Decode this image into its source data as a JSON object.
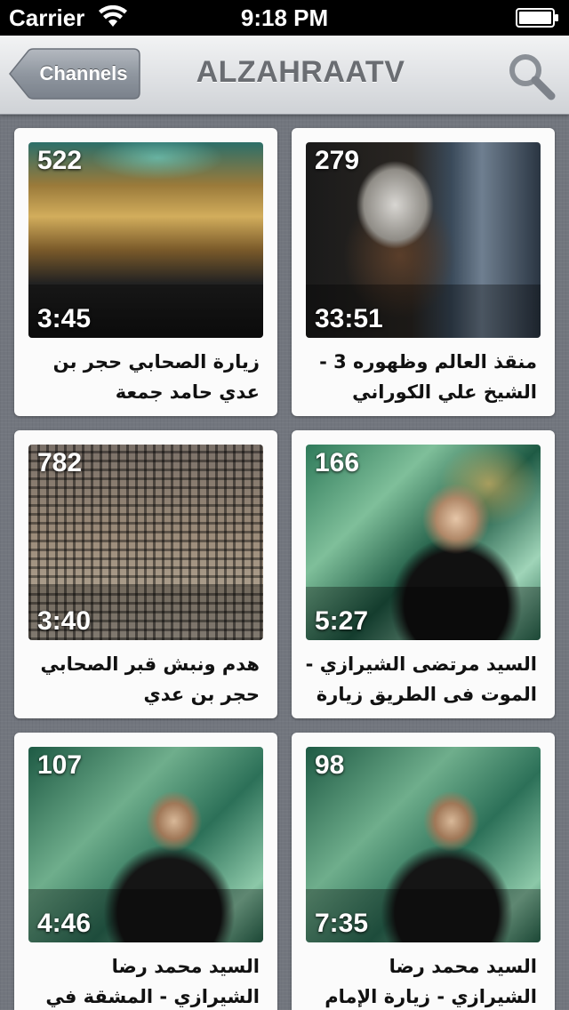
{
  "status_bar": {
    "carrier": "Carrier",
    "time": "9:18 PM"
  },
  "nav": {
    "back_label": "Channels",
    "title": "ALZAHRAATV",
    "search_icon": "magnifier-icon"
  },
  "colors": {
    "nav_title": "#6a6d72",
    "back_button": "#8a9099",
    "background": "#72767e",
    "card": "#fbfbfb"
  },
  "videos": [
    {
      "views": "522",
      "duration": "3:45",
      "title": "زيارة الصحابي  حجر بن عدي  حامد جمعة"
    },
    {
      "views": "279",
      "duration": "33:51",
      "title": "منقذ العالم وظهوره  3 - الشيخ علي الكوراني"
    },
    {
      "views": "782",
      "duration": "3:40",
      "title": "هدم ونبش  قبر الصحابي حجر بن عدي"
    },
    {
      "views": "166",
      "duration": "5:27",
      "title": "السيد مرتضى الشيرازي - الموت فى الطريق زيارة ال..."
    },
    {
      "views": "107",
      "duration": "4:46",
      "title": "السيد محمد رضا الشيرازي - المشقة في زيارة الإمام..."
    },
    {
      "views": "98",
      "duration": "7:35",
      "title": "السيد محمد رضا الشيرازي - زيارة الإمام الحسين"
    }
  ]
}
